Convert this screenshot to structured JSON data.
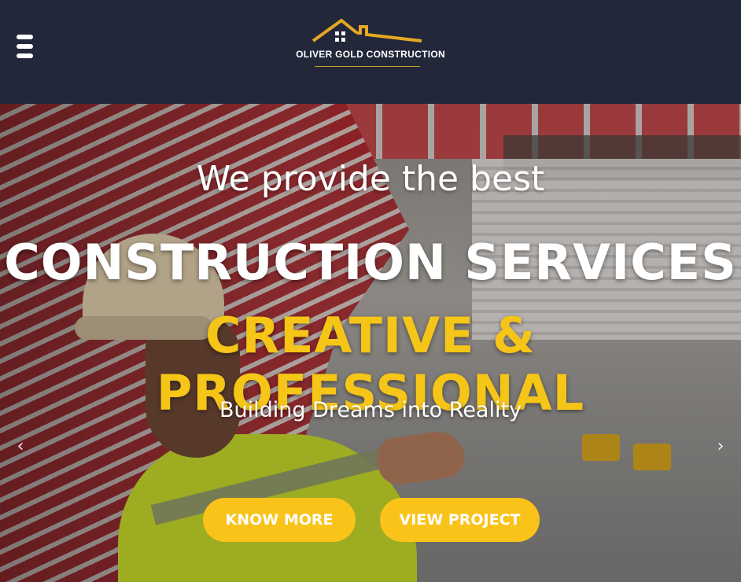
{
  "header": {
    "menu_icon": "hamburger-menu-icon",
    "logo_icon": "house-roof-icon",
    "logo_text": "OLIVER GOLD CONSTRUCTION"
  },
  "hero": {
    "line1": "We provide the best",
    "line2": "CONSTRUCTION SERVICES",
    "line3": "CREATIVE & PROFESSIONAL",
    "tagline": "Building Dreams into Reality",
    "prev_arrow": "‹",
    "next_arrow": "›",
    "buttons": {
      "know_more": "KNOW MORE",
      "view_project": "VIEW PROJECT"
    }
  },
  "colors": {
    "header_bg": "#22283a",
    "accent": "#f9c31a",
    "logo_gold": "#e5a820",
    "text_white": "#ffffff"
  }
}
